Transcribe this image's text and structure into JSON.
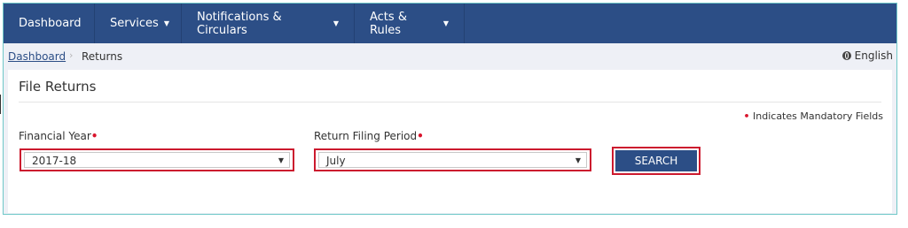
{
  "nav": {
    "items": [
      {
        "label": "Dashboard",
        "caret": false
      },
      {
        "label": "Services",
        "caret": true
      },
      {
        "label": "Notifications & Circulars",
        "caret": true
      },
      {
        "label": "Acts & Rules",
        "caret": true
      }
    ],
    "caret_glyph": "▼"
  },
  "breadcrumb": {
    "home": "Dashboard",
    "separator": "›",
    "current": "Returns"
  },
  "language": {
    "label": "English",
    "icon": "globe-icon"
  },
  "panel": {
    "title": "File Returns",
    "mandatory_note": "Indicates Mandatory Fields",
    "required_marker": "•"
  },
  "form": {
    "financial_year": {
      "label": "Financial Year",
      "value": "2017-18"
    },
    "return_period": {
      "label": "Return Filing Period",
      "value": "July"
    },
    "search_label": "SEARCH"
  },
  "colors": {
    "nav_bg": "#2c4e86",
    "highlight_border": "#cc1a2e",
    "required": "#d9142c",
    "frame_border": "#6fc8c8"
  }
}
